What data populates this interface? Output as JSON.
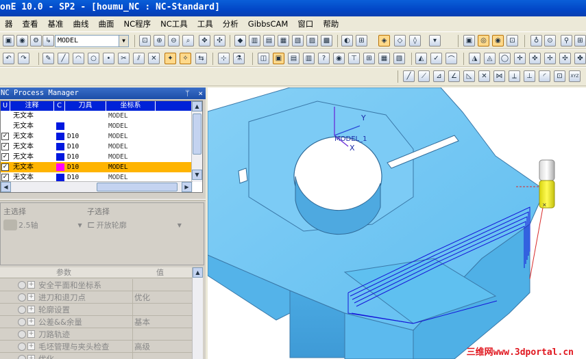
{
  "window": {
    "title": "onE 10.0 - SP2 - [houmu_NC : NC-Standard]"
  },
  "menu": [
    "器",
    "查看",
    "基准",
    "曲线",
    "曲面",
    "NC程序",
    "NC工具",
    "工具",
    "分析",
    "GibbsCAM",
    "窗口",
    "帮助"
  ],
  "toolbar": {
    "model_combo_value": "MODEL"
  },
  "nc_process_manager": {
    "title": "NC Process Manager",
    "pin_label": "ᛘ",
    "close_label": "×",
    "columns": [
      "U",
      "注释",
      "C",
      "刀具",
      "坐标系"
    ],
    "rows": [
      {
        "checked": false,
        "note": "无文本",
        "color": "",
        "tool": "",
        "coord": "MODEL",
        "selected": false
      },
      {
        "checked": false,
        "note": "无文本",
        "color": "#0018e0",
        "tool": "",
        "coord": "MODEL",
        "selected": false
      },
      {
        "checked": true,
        "note": "无文本",
        "color": "#0018e0",
        "tool": "D10",
        "coord": "MODEL",
        "selected": false
      },
      {
        "checked": true,
        "note": "无文本",
        "color": "#0018e0",
        "tool": "D10",
        "coord": "MODEL",
        "selected": false
      },
      {
        "checked": true,
        "note": "无文本",
        "color": "#0018e0",
        "tool": "D10",
        "coord": "MODEL",
        "selected": false
      },
      {
        "checked": true,
        "note": "无文本",
        "color": "#ff00ff",
        "tool": "D10",
        "coord": "MODEL",
        "selected": true
      },
      {
        "checked": true,
        "note": "无文本",
        "color": "#0018e0",
        "tool": "D10",
        "coord": "MODEL",
        "selected": false
      }
    ]
  },
  "selection": {
    "main_label": "主选择",
    "sub_label": "子选择",
    "main_value": "2.5轴",
    "sub_value": "开放轮廓"
  },
  "params": {
    "header_param": "参数",
    "header_value": "值",
    "rows": [
      {
        "name": "安全平面和坐标系",
        "value": ""
      },
      {
        "name": "进刀和退刀点",
        "value": "优化"
      },
      {
        "name": "轮廓设置",
        "value": ""
      },
      {
        "name": "公差&&余量",
        "value": "基本"
      },
      {
        "name": "刀路轨迹",
        "value": ""
      },
      {
        "name": "毛坯管理与夹头检查",
        "value": "高级"
      },
      {
        "name": "优化",
        "value": ""
      }
    ]
  },
  "viewport": {
    "csys_label": "MODEL_1",
    "axis_y": "Y",
    "axis_x": "X",
    "triad_label": "XYZ",
    "watermark": "三维网www.3dportal.cn",
    "model_color": "#6fc6f4",
    "toolpath_color": "#1414d8",
    "tool_color": "#f1ee2a"
  }
}
